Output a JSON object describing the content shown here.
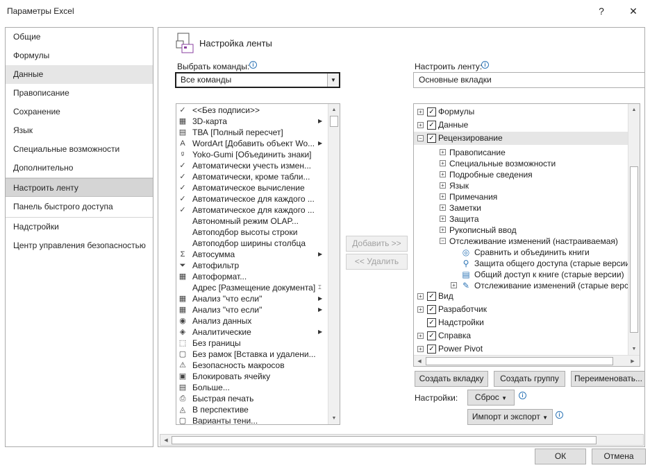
{
  "window": {
    "title": "Параметры Excel",
    "help": "?",
    "close": "✕"
  },
  "sidebar": {
    "items": [
      {
        "label": "Общие"
      },
      {
        "label": "Формулы"
      },
      {
        "label": "Данные"
      },
      {
        "label": "Правописание"
      },
      {
        "label": "Сохранение"
      },
      {
        "label": "Язык"
      },
      {
        "label": "Специальные возможности"
      },
      {
        "label": "Дополнительно"
      },
      {
        "label": "Настроить ленту"
      },
      {
        "label": "Панель быстрого доступа"
      },
      {
        "label": "Надстройки"
      },
      {
        "label": "Центр управления безопасностью"
      }
    ]
  },
  "header": {
    "title": "Настройка ленты"
  },
  "left": {
    "choose_label": "Выбрать команды:",
    "choose_value": "Все команды",
    "commands": [
      {
        "icon": "✓",
        "label": "<<Без подписи>>",
        "sub": ""
      },
      {
        "icon": "▦",
        "label": "3D-карта",
        "sub": "▶"
      },
      {
        "icon": "▤",
        "label": "ТВА [Полный пересчет]",
        "sub": ""
      },
      {
        "icon": "A",
        "label": "WordArt [Добавить объект Wo...",
        "sub": "▶"
      },
      {
        "icon": "ᵍ",
        "label": "Yoko-Gumi [Объединить знаки]",
        "sub": ""
      },
      {
        "icon": "✓",
        "label": "Автоматически учесть измен...",
        "sub": ""
      },
      {
        "icon": "✓",
        "label": "Автоматически, кроме табли...",
        "sub": ""
      },
      {
        "icon": "✓",
        "label": "Автоматическое вычисление",
        "sub": ""
      },
      {
        "icon": "✓",
        "label": "Автоматическое для каждого ...",
        "sub": ""
      },
      {
        "icon": "✓",
        "label": "Автоматическое для каждого ...",
        "sub": ""
      },
      {
        "icon": "",
        "label": "Автономный режим OLAP...",
        "sub": ""
      },
      {
        "icon": "",
        "label": "Автоподбор высоты строки",
        "sub": ""
      },
      {
        "icon": "",
        "label": "Автоподбор ширины столбца",
        "sub": ""
      },
      {
        "icon": "Σ",
        "label": "Автосумма",
        "sub": "▶"
      },
      {
        "icon": "⏷",
        "label": "Автофильтр",
        "sub": ""
      },
      {
        "icon": "▦",
        "label": "Автоформат...",
        "sub": ""
      },
      {
        "icon": "",
        "label": "Адрес [Размещение документа]",
        "sub": "⌶"
      },
      {
        "icon": "▦",
        "label": "Анализ \"что если\"",
        "sub": "▶"
      },
      {
        "icon": "▦",
        "label": "Анализ \"что если\"",
        "sub": "▶"
      },
      {
        "icon": "◉",
        "label": "Анализ данных",
        "sub": ""
      },
      {
        "icon": "◈",
        "label": "Аналитические",
        "sub": "▶"
      },
      {
        "icon": "⬚",
        "label": "Без границы",
        "sub": ""
      },
      {
        "icon": "▢",
        "label": "Без рамок [Вставка и удалени...",
        "sub": ""
      },
      {
        "icon": "⚠",
        "label": "Безопасность макросов",
        "sub": ""
      },
      {
        "icon": "▣",
        "label": "Блокировать ячейку",
        "sub": ""
      },
      {
        "icon": "▤",
        "label": "Больше...",
        "sub": ""
      },
      {
        "icon": "⎙",
        "label": "Быстрая печать",
        "sub": ""
      },
      {
        "icon": "◬",
        "label": "В перспективе",
        "sub": ""
      },
      {
        "icon": "▢",
        "label": "Варианты тени...",
        "sub": ""
      }
    ]
  },
  "middle": {
    "add": "Добавить >>",
    "remove": "<< Удалить"
  },
  "right": {
    "customize_label": "Настроить ленту:",
    "customize_value": "Основные вкладки",
    "tree_top": [
      {
        "label": "Формулы",
        "checked": "✓",
        "exp": "+"
      },
      {
        "label": "Данные",
        "checked": "✓",
        "exp": "+"
      },
      {
        "label": "Рецензирование",
        "checked": "✓",
        "exp": "−"
      }
    ],
    "groups": [
      {
        "label": "Правописание"
      },
      {
        "label": "Специальные возможности"
      },
      {
        "label": "Подробные сведения"
      },
      {
        "label": "Язык"
      },
      {
        "label": "Примечания"
      },
      {
        "label": "Заметки"
      },
      {
        "label": "Защита"
      },
      {
        "label": "Рукописный ввод"
      },
      {
        "label": "Отслеживание изменений (настраиваемая)"
      }
    ],
    "custom_items": [
      {
        "label": "Сравнить и объединить книги"
      },
      {
        "label": "Защита общего доступа (старые версии)"
      },
      {
        "label": "Общий доступ к книге (старые версии)"
      },
      {
        "label": "Отслеживание изменений (старые версии"
      }
    ],
    "tree_bottom": [
      {
        "label": "Вид",
        "checked": "✓"
      },
      {
        "label": "Разработчик",
        "checked": "✓"
      },
      {
        "label": "Надстройки",
        "checked": "✓"
      },
      {
        "label": "Справка",
        "checked": "✓"
      },
      {
        "label": "Power Pivot",
        "checked": "✓"
      }
    ],
    "new_tab": "Создать вкладку",
    "new_group": "Создать группу",
    "rename": "Переименовать...",
    "settings_label": "Настройки:",
    "reset": "Сброс",
    "import_export": "Импорт и экспорт"
  },
  "footer": {
    "ok": "ОК",
    "cancel": "Отмена"
  }
}
